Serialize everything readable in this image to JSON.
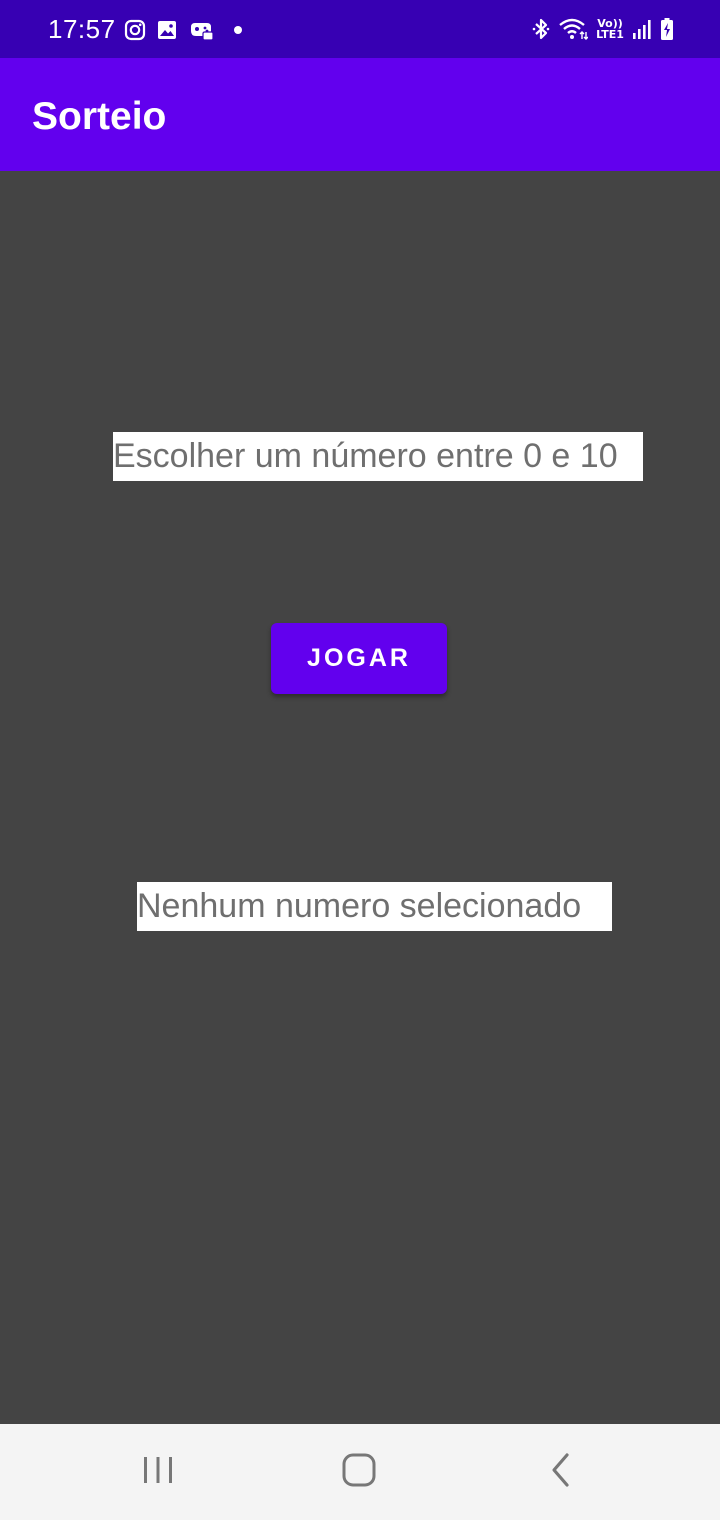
{
  "status_bar": {
    "time": "17:57",
    "left_icons": [
      "instagram-icon",
      "gallery-icon",
      "game-launcher-icon",
      "notification-dot-icon"
    ],
    "right_icons": [
      "bluetooth-icon",
      "wifi-icon",
      "volte-icon",
      "signal-icon",
      "battery-charging-icon"
    ],
    "volte_line1": "Vo))",
    "volte_line2": "LTE1"
  },
  "app_bar": {
    "title": "Sorteio",
    "color": "#6200ee"
  },
  "main": {
    "prompt": "Escolher um número entre 0 e 10",
    "play_button_label": "JOGAR",
    "result": "Nenhum numero selecionado"
  },
  "nav_bar": {
    "buttons": [
      "recent-apps-icon",
      "home-icon",
      "back-icon"
    ]
  },
  "colors": {
    "status_bar": "#3700b3",
    "primary": "#6200ee",
    "background": "#444444",
    "nav_bar": "#f4f4f4"
  }
}
